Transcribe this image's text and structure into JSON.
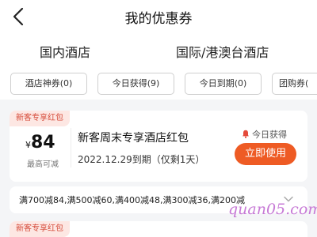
{
  "header": {
    "title": "我的优惠券"
  },
  "tabs": [
    {
      "label": "国内酒店"
    },
    {
      "label": "国际/港澳台酒店"
    }
  ],
  "filters": [
    {
      "label": "酒店神券(0)"
    },
    {
      "label": "今日获得(9)"
    },
    {
      "label": "今日到期(0)"
    },
    {
      "label": "团购券("
    }
  ],
  "coupon": {
    "tag": "新客专享红包",
    "currency": "¥",
    "amount": "84",
    "amount_note": "最高可减",
    "title": "新客周末专享酒店红包",
    "expiry": "2022.12.29到期（仅剩1天）",
    "obtained_label": "今日获得",
    "use_button": "立即使用",
    "rules": "满700减84,满500减60,满400减48,满300减36,满200减"
  },
  "next_coupon": {
    "tag": "新客专享红包"
  },
  "watermark": "quan05.com",
  "colors": {
    "accent": "#ee5b24",
    "tag_bg": "#fde7e3",
    "tag_text": "#d54b3a",
    "tab_active": "#1e3f9a"
  }
}
